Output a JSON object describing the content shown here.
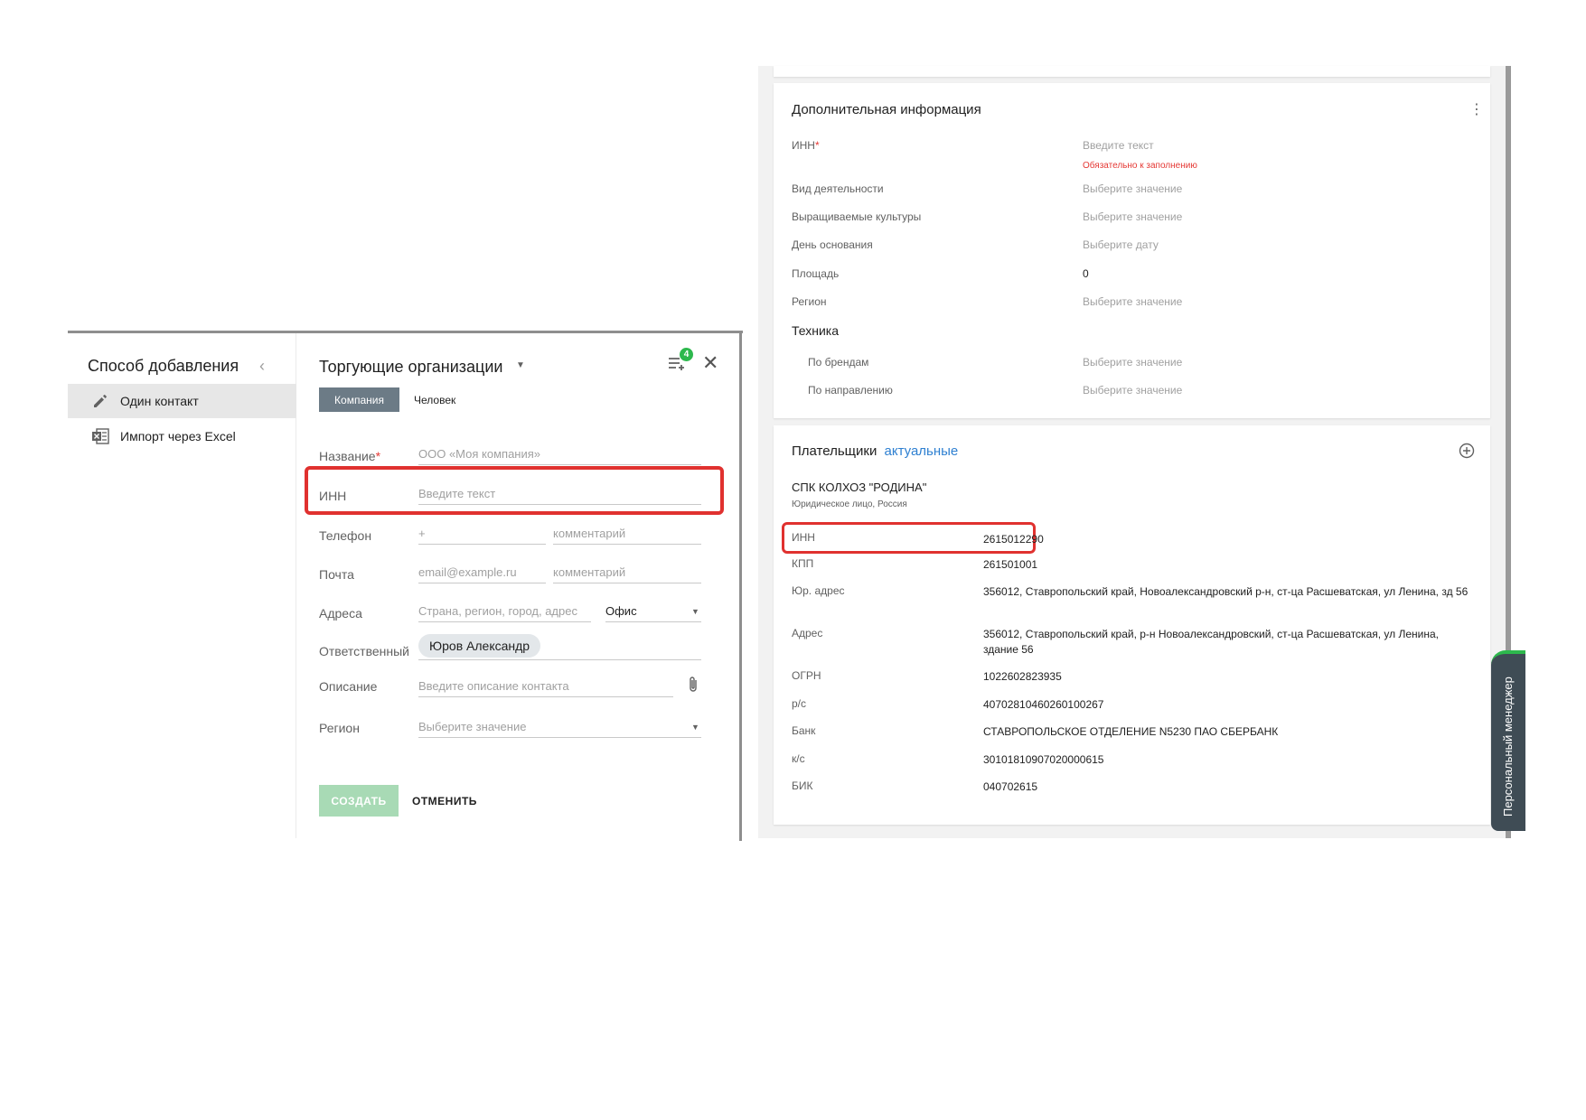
{
  "left": {
    "sidebar": {
      "title": "Способ добавления",
      "collapse_icon": "chevron-left-icon",
      "items": [
        {
          "label": "Один контакт",
          "icon": "pencil-icon",
          "active": true
        },
        {
          "label": "Импорт через Excel",
          "icon": "excel-icon",
          "active": false
        }
      ]
    },
    "form": {
      "title": "Торгующие организации",
      "queue_badge": "4",
      "tabs": {
        "company": "Компания",
        "person": "Человек"
      },
      "fields": {
        "name": {
          "label": "Название",
          "required_mark": "*",
          "placeholder": "ООО «Моя компания»"
        },
        "inn": {
          "label": "ИНН",
          "placeholder": "Введите текст"
        },
        "phone": {
          "label": "Телефон",
          "placeholder": "+",
          "comment_placeholder": "комментарий"
        },
        "email": {
          "label": "Почта",
          "placeholder": "email@example.ru",
          "comment_placeholder": "комментарий"
        },
        "address": {
          "label": "Адреса",
          "placeholder": "Страна, регион, город, адрес",
          "type_value": "Офис"
        },
        "responsible": {
          "label": "Ответственный",
          "value": "Юров Александр"
        },
        "description": {
          "label": "Описание",
          "placeholder": "Введите описание контакта"
        },
        "region": {
          "label": "Регион",
          "placeholder": "Выберите значение"
        }
      },
      "create_label": "СОЗДАТЬ",
      "cancel_label": "ОТМЕНИТЬ"
    }
  },
  "right": {
    "info": {
      "title": "Дополнительная информация",
      "inn": {
        "label": "ИНН",
        "required_mark": "*",
        "placeholder": "Введите текст",
        "error": "Обязательно к заполнению"
      },
      "rows": [
        {
          "label": "Вид деятельности",
          "value": "Выберите значение"
        },
        {
          "label": "Выращиваемые культуры",
          "value": "Выберите значение"
        },
        {
          "label": "День основания",
          "value": "Выберите дату"
        },
        {
          "label": "Площадь",
          "value": "0"
        },
        {
          "label": "Регион",
          "value": "Выберите значение"
        }
      ],
      "tech_title": "Техника",
      "tech_rows": [
        {
          "label": "По брендам",
          "value": "Выберите значение"
        },
        {
          "label": "По направлению",
          "value": "Выберите значение"
        }
      ]
    },
    "payers": {
      "title": "Плательщики",
      "title_link": "актуальные",
      "company_name": "СПК КОЛХОЗ \"РОДИНА\"",
      "company_type": "Юридическое лицо, Россия",
      "rows": [
        {
          "label": "ИНН",
          "value": "2615012290"
        },
        {
          "label": "КПП",
          "value": "261501001"
        },
        {
          "label": "Юр. адрес",
          "value": "356012, Ставропольский край, Новоалександровский р-н, ст-ца Расшеватская, ул Ленина, зд 56"
        },
        {
          "label": "Адрес",
          "value": "356012, Ставропольский край, р-н Новоалександровский, ст-ца Расшеватская, ул Ленина, здание 56"
        },
        {
          "label": "ОГРН",
          "value": "1022602823935"
        },
        {
          "label": "р/с",
          "value": "40702810460260100267"
        },
        {
          "label": "Банк",
          "value": "СТАВРОПОЛЬСКОЕ ОТДЕЛЕНИЕ N5230 ПАО СБЕРБАНК"
        },
        {
          "label": "к/с",
          "value": "30101810907020000615"
        },
        {
          "label": "БИК",
          "value": "040702615"
        }
      ]
    },
    "manager_tab": "Персональный менеджер"
  },
  "colors": {
    "accent_green": "#2db84d",
    "highlight_red": "#e0312f",
    "link_blue": "#2f80d1",
    "tab_gray": "#6c7b86"
  }
}
